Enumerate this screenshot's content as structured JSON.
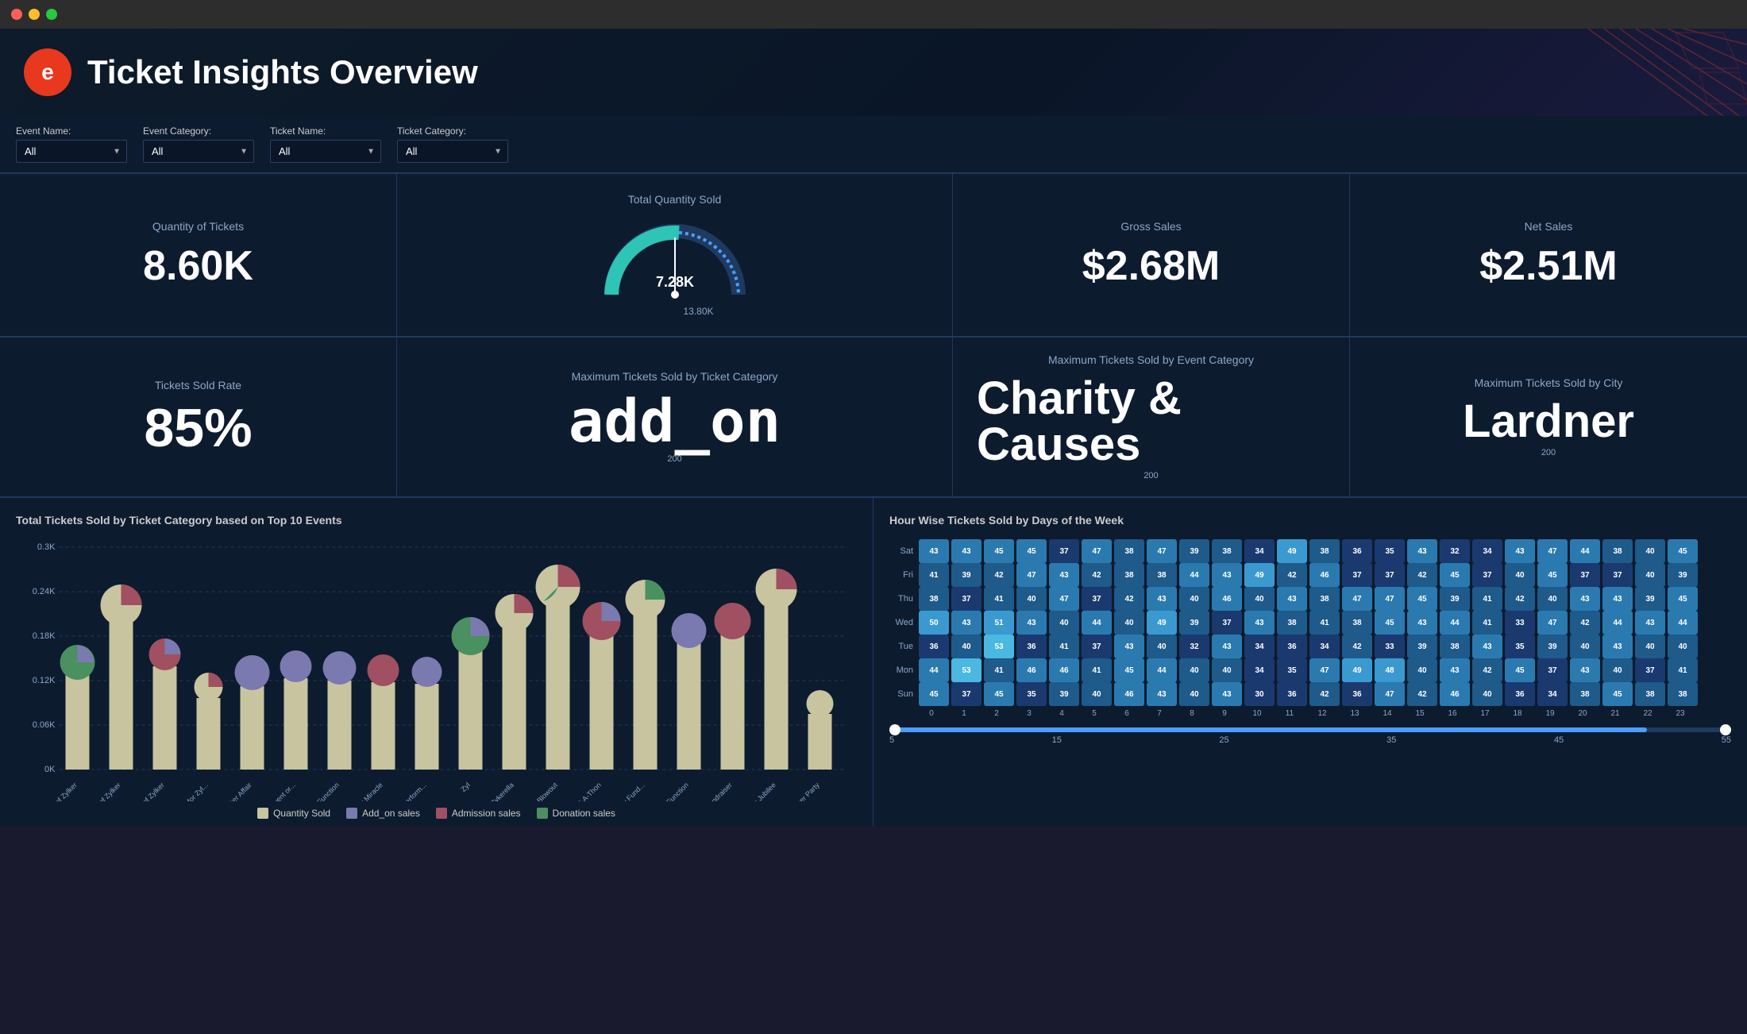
{
  "window": {
    "title": "Ticket Insights Overview"
  },
  "header": {
    "logo_letter": "e",
    "title": "Ticket Insights Overview"
  },
  "filters": {
    "event_name_label": "Event Name:",
    "event_name_value": "All",
    "event_category_label": "Event Category:",
    "event_category_value": "All",
    "ticket_name_label": "Ticket Name:",
    "ticket_name_value": "All",
    "ticket_category_label": "Ticket Category:",
    "ticket_category_value": "All"
  },
  "kpi_row1": {
    "quantity_label": "Quantity of Tickets",
    "quantity_value": "8.60K",
    "total_qty_label": "Total Quantity Sold",
    "gauge_current": "7.28K",
    "gauge_max": "13.80K",
    "gross_label": "Gross Sales",
    "gross_value": "$2.68M",
    "net_label": "Net Sales",
    "net_value": "$2.51M"
  },
  "kpi_row2": {
    "rate_label": "Tickets Sold Rate",
    "rate_value": "85%",
    "max_ticket_cat_label": "Maximum Tickets Sold by Ticket Category",
    "max_ticket_cat_value": "add_on",
    "max_ticket_cat_sub": "200",
    "max_event_cat_label": "Maximum Tickets Sold by Event Category",
    "max_event_cat_value": "Charity & Causes",
    "max_event_cat_sub": "200",
    "max_city_label": "Maximum Tickets Sold by City",
    "max_city_value": "Lardner",
    "max_city_sub": "200"
  },
  "bar_chart": {
    "title": "Total Tickets Sold by Ticket Category based on Top 10 Events",
    "y_labels": [
      "0K",
      "0.06K",
      "0.12K",
      "0.18K",
      "0.24K",
      "0.3K"
    ],
    "legend": [
      {
        "label": "Quantity Sold",
        "color": "#c8c4a0"
      },
      {
        "label": "Add_on sales",
        "color": "#7a7ab0"
      },
      {
        "label": "Admission sales",
        "color": "#a05060"
      },
      {
        "label": "Donation sales",
        "color": "#4a9060"
      }
    ],
    "events": [
      "A Spree of Zylker",
      "A Triumph of Zylker",
      "An Evening of Zylker",
      "An Occasion for Zyl...",
      "A Zylker Affair",
      "The Zylker Event or...",
      "The Zylker Function",
      "The Zylker Miracle",
      "The Zylker Perform...",
      "Zyl",
      "Zykerella",
      "Zylker Blowout",
      "Zylker Bowl-A-Thon",
      "Zylker Charity Fund...",
      "Zylker Function",
      "Zylker Fundraiser",
      "Zylker Jubilee",
      "Zylker Party"
    ]
  },
  "heatmap": {
    "title": "Hour Wise Tickets Sold by Days of the Week",
    "days": [
      "Sat",
      "Fri",
      "Thu",
      "Wed",
      "Tue",
      "Mon",
      "Sun"
    ],
    "hours": [
      "0",
      "1",
      "2",
      "3",
      "4",
      "5",
      "6",
      "7",
      "8",
      "9",
      "10",
      "11",
      "12",
      "13",
      "14",
      "15",
      "16",
      "17",
      "18",
      "19",
      "20",
      "21",
      "22",
      "23"
    ],
    "slider_min": "5",
    "slider_max": "55",
    "slider_labels": [
      "5",
      "15",
      "25",
      "35",
      "45",
      "55"
    ],
    "data": {
      "Sat": [
        43,
        43,
        45,
        45,
        37,
        47,
        38,
        47,
        39,
        38,
        34,
        49,
        38,
        36,
        35,
        43,
        32,
        34,
        43,
        47,
        44,
        38,
        40,
        45
      ],
      "Fri": [
        41,
        39,
        42,
        47,
        43,
        42,
        38,
        38,
        44,
        43,
        49,
        42,
        46,
        37,
        37,
        42,
        45,
        37,
        40,
        45,
        37,
        37,
        40,
        39
      ],
      "Thu": [
        38,
        37,
        41,
        40,
        47,
        37,
        42,
        43,
        40,
        46,
        40,
        43,
        38,
        47,
        47,
        45,
        39,
        41,
        42,
        40,
        43,
        43,
        39,
        45
      ],
      "Wed": [
        50,
        43,
        51,
        43,
        40,
        44,
        40,
        49,
        39,
        37,
        43,
        38,
        41,
        38,
        45,
        43,
        44,
        41,
        33,
        47,
        42,
        44,
        43,
        44
      ],
      "Tue": [
        36,
        40,
        53,
        36,
        41,
        37,
        43,
        40,
        32,
        43,
        34,
        36,
        34,
        42,
        33,
        39,
        38,
        43,
        35,
        39,
        40,
        43,
        40,
        40
      ],
      "Mon": [
        44,
        53,
        41,
        46,
        46,
        41,
        45,
        44,
        40,
        40,
        34,
        35,
        47,
        49,
        48,
        40,
        43,
        42,
        45,
        37,
        43,
        40,
        37,
        41
      ],
      "Sun": [
        45,
        37,
        45,
        35,
        39,
        40,
        46,
        43,
        40,
        43,
        30,
        36,
        42,
        36,
        47,
        42,
        46,
        40,
        36,
        34,
        38,
        45,
        38,
        38
      ]
    }
  }
}
